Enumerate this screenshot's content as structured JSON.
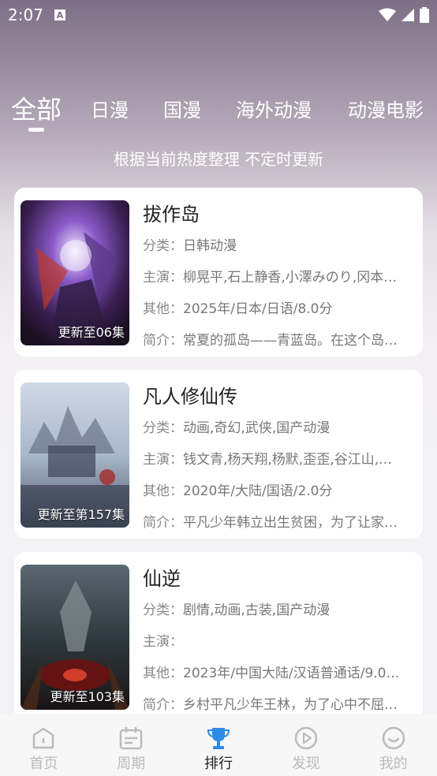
{
  "status": {
    "time": "2:07"
  },
  "tabs": [
    {
      "label": "全部",
      "active": true
    },
    {
      "label": "日漫"
    },
    {
      "label": "国漫"
    },
    {
      "label": "海外动漫"
    },
    {
      "label": "动漫电影"
    }
  ],
  "subtitle": "根据当前热度整理 不定时更新",
  "labels": {
    "category": "分类：",
    "cast": "主演：",
    "other": "其他：",
    "intro": "简介："
  },
  "items": [
    {
      "title": "拔作岛",
      "category": "日韩动漫",
      "cast": "柳晃平,石上静香,小澤みのり,冈本…",
      "other": "2025年/日本/日语/8.0分",
      "intro": "常夏的孤岛——青蓝岛。在这个岛…",
      "update": "更新至06集"
    },
    {
      "title": "凡人修仙传",
      "category": "动画,奇幻,武侠,国产动漫",
      "cast": "钱文青,杨天翔,杨默,歪歪,谷江山,…",
      "other": "2020年/大陆/国语/2.0分",
      "intro": "平凡少年韩立出生贫困，为了让家…",
      "update": "更新至第157集"
    },
    {
      "title": "仙逆",
      "category": "剧情,动画,古装,国产动漫",
      "cast": "",
      "other": "2023年/中国大陆/汉语普通话/9.0…",
      "intro": "乡村平凡少年王林，为了心中不屈…",
      "update": "更新至103集"
    }
  ],
  "nav": [
    {
      "label": "首页",
      "icon": "home-icon"
    },
    {
      "label": "周期",
      "icon": "calendar-icon"
    },
    {
      "label": "排行",
      "icon": "trophy-icon",
      "active": true
    },
    {
      "label": "发现",
      "icon": "play-icon"
    },
    {
      "label": "我的",
      "icon": "profile-icon"
    }
  ]
}
